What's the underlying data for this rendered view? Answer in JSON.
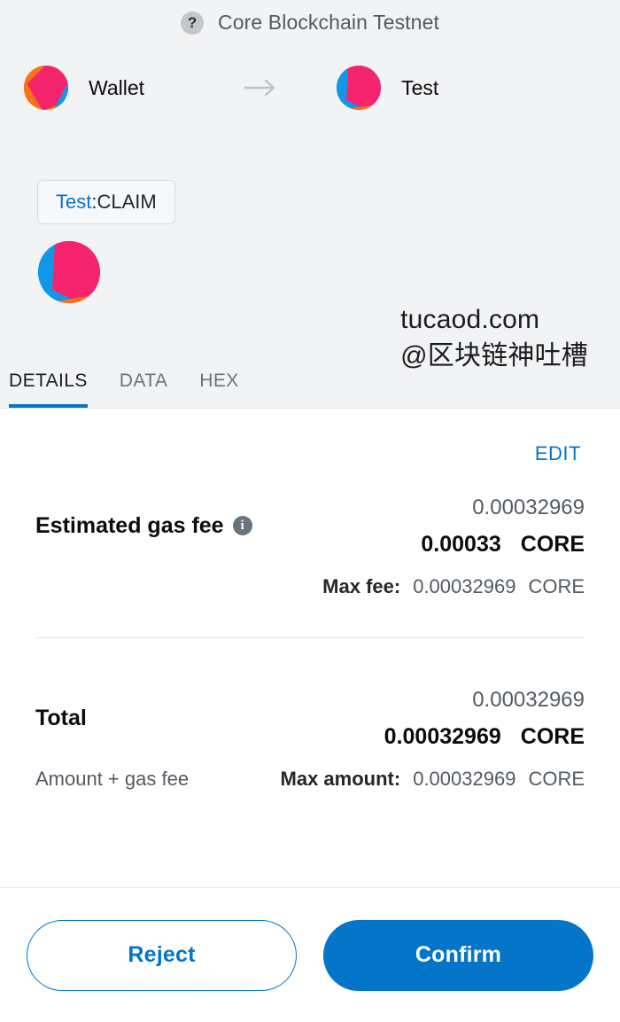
{
  "header": {
    "help_icon": "question-mark-icon",
    "network_name": "Core Blockchain Testnet",
    "from_account": {
      "name": "Wallet",
      "identicon": "identicon-wallet"
    },
    "transfer_arrow_icon": "arrow-right-icon",
    "to_account": {
      "name": "Test",
      "identicon": "identicon-test"
    },
    "origin": {
      "network": "Test",
      "separator": " : ",
      "action": "CLAIM"
    },
    "subject_identicon": "identicon-test-large"
  },
  "watermark": {
    "line1": "tucaod.com",
    "line2": "@区块链神吐槽"
  },
  "tabs": [
    {
      "label": "DETAILS",
      "active": true
    },
    {
      "label": "DATA",
      "active": false
    },
    {
      "label": "HEX",
      "active": false
    }
  ],
  "details": {
    "edit_label": "EDIT",
    "gas_fee": {
      "label": "Estimated gas fee",
      "info_icon": "info-icon",
      "secondary_amount": "0.00032969",
      "primary_amount": "0.00033",
      "currency": "CORE",
      "max_label": "Max fee:",
      "max_amount": "0.00032969",
      "max_currency": "CORE"
    },
    "total": {
      "label": "Total",
      "secondary_amount": "0.00032969",
      "primary_amount": "0.00032969",
      "currency": "CORE",
      "subtitle": "Amount + gas fee",
      "max_label": "Max amount:",
      "max_amount": "0.00032969",
      "max_currency": "CORE"
    }
  },
  "footer": {
    "reject_label": "Reject",
    "confirm_label": "Confirm"
  },
  "colors": {
    "accent_blue": "#0376c9",
    "header_bg": "#f2f3f4",
    "text_dark": "#0b0c0e",
    "text_muted": "#535a61",
    "identicon_pink": "#f5246d",
    "identicon_blue": "#1098e8",
    "identicon_orange": "#fa7216"
  }
}
